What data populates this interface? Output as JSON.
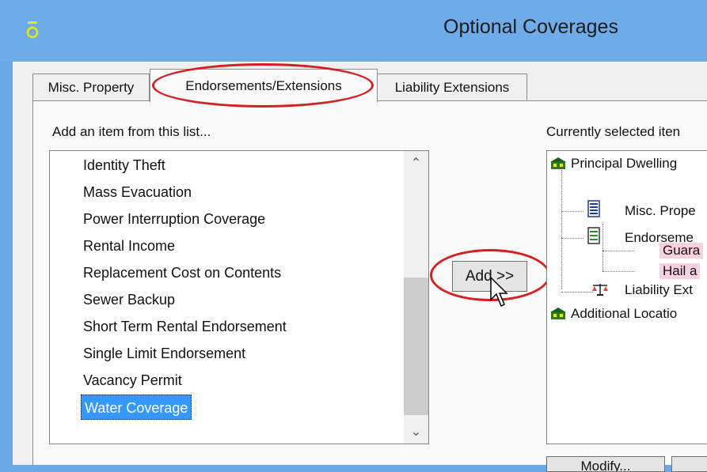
{
  "window": {
    "title": "Optional Coverages"
  },
  "tabs": [
    {
      "label": "Misc. Property"
    },
    {
      "label": "Endorsements/Extensions"
    },
    {
      "label": "Liability Extensions"
    }
  ],
  "left_panel": {
    "label": "Add an item from this list...",
    "items": [
      "Identity Theft",
      "Mass Evacuation",
      "Power Interruption Coverage",
      "Rental Income",
      "Replacement Cost on Contents",
      "Sewer Backup",
      "Short Term Rental Endorsement",
      "Single Limit Endorsement",
      "Vacancy Permit",
      "Water Coverage"
    ],
    "selected": "Water Coverage"
  },
  "add_button": {
    "label": "Add >>"
  },
  "right_panel": {
    "label": "Currently selected iten",
    "tree": {
      "root": "Principal Dwelling",
      "misc": "Misc. Prope",
      "endorse": "Endorseme",
      "guar": "Guara",
      "hail": "Hail a",
      "liability": "Liability Ext",
      "additional": "Additional Locatio"
    }
  },
  "bottom": {
    "modify_label": "Modify..."
  },
  "colors": {
    "selection": "#3399ff",
    "highlight_oval": "#d42020",
    "pink": "#f8d0e0",
    "titlebar": "#6fabe8"
  }
}
